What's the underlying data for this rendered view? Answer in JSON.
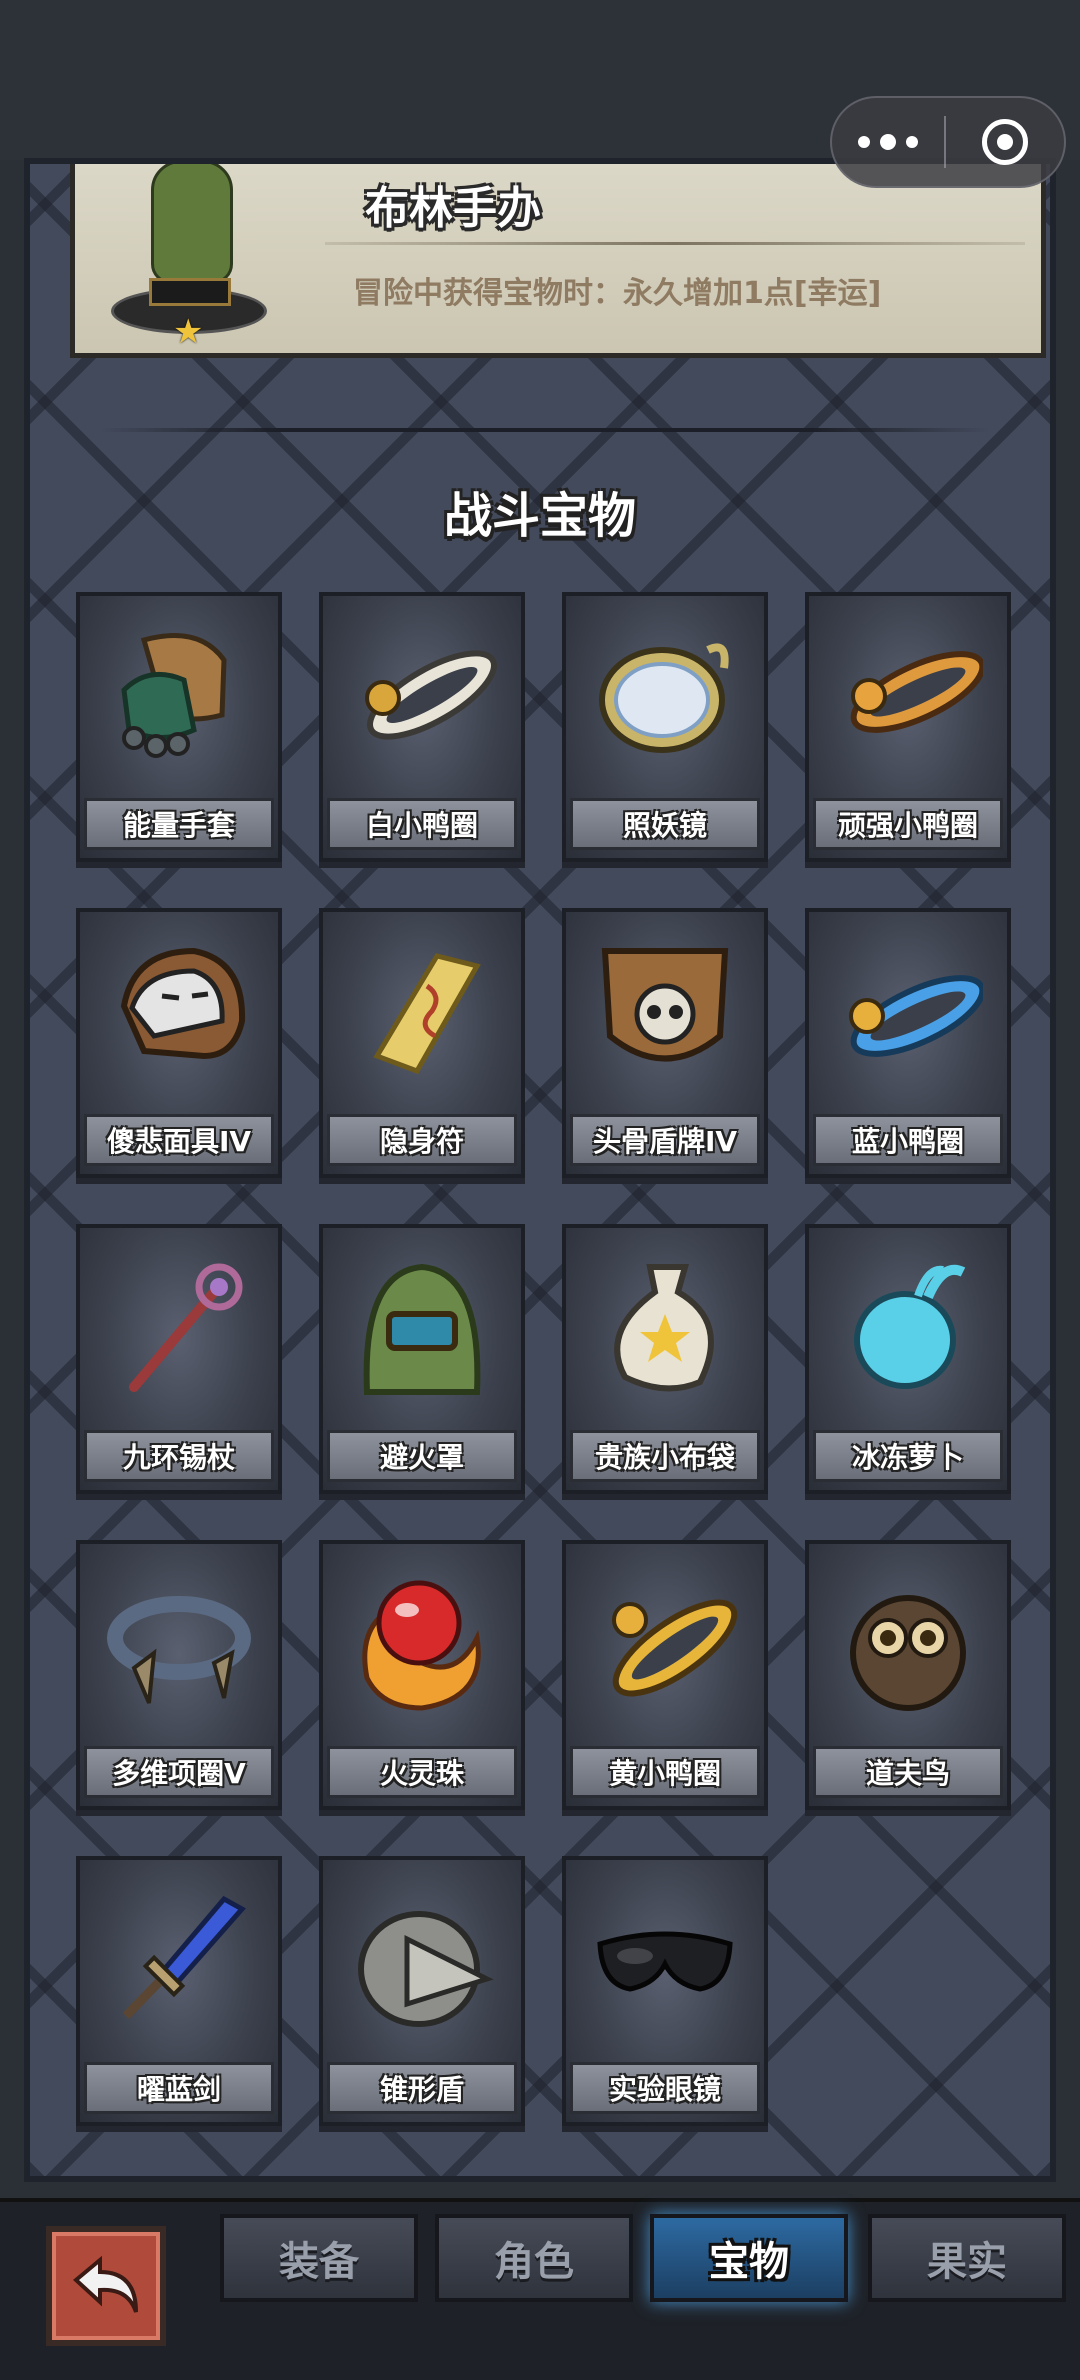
{
  "card": {
    "title": "布林手办",
    "description": "冒险中获得宝物时：永久增加1点[幸运]"
  },
  "section_title": "战斗宝物",
  "items": [
    {
      "label": "能量手套",
      "icon": "glove-icon"
    },
    {
      "label": "白小鸭圈",
      "icon": "white-duck-ring-icon"
    },
    {
      "label": "照妖镜",
      "icon": "mirror-icon"
    },
    {
      "label": "顽强小鸭圈",
      "icon": "orange-duck-ring-icon"
    },
    {
      "label": "傻悲面具IV",
      "icon": "mask-icon"
    },
    {
      "label": "隐身符",
      "icon": "talisman-icon"
    },
    {
      "label": "头骨盾牌IV",
      "icon": "skull-shield-icon"
    },
    {
      "label": "蓝小鸭圈",
      "icon": "blue-duck-ring-icon"
    },
    {
      "label": "九环锡杖",
      "icon": "staff-icon"
    },
    {
      "label": "避火罩",
      "icon": "fire-hood-icon"
    },
    {
      "label": "贵族小布袋",
      "icon": "cloth-bag-icon"
    },
    {
      "label": "冰冻萝卜",
      "icon": "frozen-radish-icon"
    },
    {
      "label": "多维项圈V",
      "icon": "collar-icon"
    },
    {
      "label": "火灵珠",
      "icon": "fire-orb-icon"
    },
    {
      "label": "黄小鸭圈",
      "icon": "yellow-duck-ring-icon"
    },
    {
      "label": "道夫鸟",
      "icon": "owl-icon"
    },
    {
      "label": "曜蓝剑",
      "icon": "blue-sword-icon"
    },
    {
      "label": "锥形盾",
      "icon": "cone-shield-icon"
    },
    {
      "label": "实验眼镜",
      "icon": "goggles-icon"
    }
  ],
  "tabs": {
    "equipment": "装备",
    "character": "角色",
    "treasure": "宝物",
    "fruit": "果实"
  },
  "active_tab": "宝物"
}
